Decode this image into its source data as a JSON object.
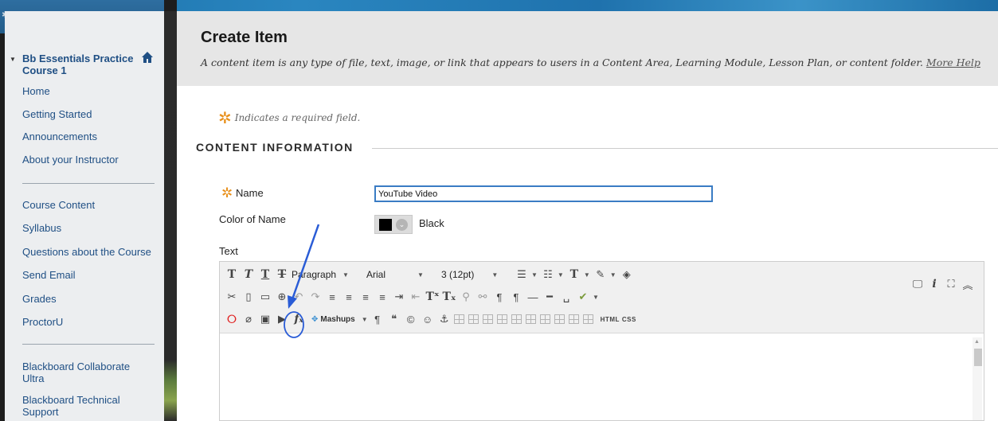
{
  "sidebar": {
    "course_title": "Bb Essentials Practice Course 1",
    "items_top": [
      "Home",
      "Getting Started",
      "Announcements",
      "About your Instructor"
    ],
    "items_mid": [
      "Course Content",
      "Syllabus",
      "Questions about the Course",
      "Send Email",
      "Grades",
      "ProctorU"
    ],
    "items_bottom": [
      "Blackboard Collaborate Ultra",
      "Blackboard Technical Support"
    ],
    "toolbar_icons": [
      "sort-icon",
      "refresh-icon",
      "folder-icon"
    ]
  },
  "header": {
    "title": "Create Item",
    "description": "A content item is any type of file, text, image, or link that appears to users in a Content Area, Learning Module, Lesson Plan, or content folder.",
    "help_link": "More Help"
  },
  "form": {
    "required_note": "Indicates a required field.",
    "section_title": "CONTENT INFORMATION",
    "name_label": "Name",
    "name_value": "YouTube Video",
    "color_label": "Color of Name",
    "color_value": "Black",
    "text_label": "Text"
  },
  "editor": {
    "paragraph": "Paragraph",
    "font": "Arial",
    "size": "3 (12pt)",
    "mashups": "Mashups",
    "html_label": "HTML",
    "css_label": "CSS"
  },
  "colors": {
    "link": "#1f4f84",
    "required": "#e8901b",
    "annotation": "#2a5cd6"
  }
}
